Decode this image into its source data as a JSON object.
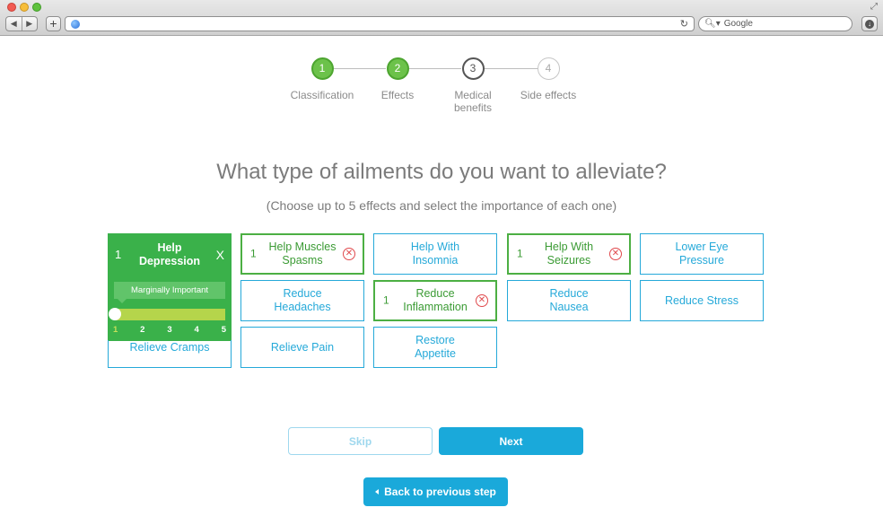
{
  "browser": {
    "search_placeholder": "Google",
    "back_glyph": "◀",
    "forward_glyph": "▶",
    "new_tab_glyph": "+",
    "reload_glyph": "↻",
    "resize_glyph": "⤢",
    "search_glyph": "🔍︎▾",
    "download_glyph": "↓"
  },
  "stepper": {
    "steps": [
      {
        "number": "1",
        "label": "Classification",
        "state": "done"
      },
      {
        "number": "2",
        "label": "Effects",
        "state": "done"
      },
      {
        "number": "3",
        "label": "Medical benefits",
        "state": "current"
      },
      {
        "number": "4",
        "label": "Side effects",
        "state": "todo"
      }
    ]
  },
  "question": {
    "title": "What type of ailments do you want to alleviate?",
    "subtitle": "(Choose up to 5 effects and select the importance of each one)"
  },
  "expanded_card": {
    "rank": "1",
    "label": "Help Depression",
    "close": "X",
    "tooltip": "Marginally Important",
    "importance": 1,
    "scale": [
      "1",
      "2",
      "3",
      "4",
      "5"
    ],
    "below_label": "Relieve Cramps"
  },
  "effects": [
    {
      "label": "Help Muscles Spasms",
      "selected": true,
      "rank": "1"
    },
    {
      "label": "Help With Insomnia",
      "selected": false
    },
    {
      "label": "Help With Seizures",
      "selected": true,
      "rank": "1"
    },
    {
      "label": "Lower Eye Pressure",
      "selected": false
    },
    {
      "label": "Reduce Headaches",
      "selected": false
    },
    {
      "label": "Reduce Inflammation",
      "selected": true,
      "rank": "1"
    },
    {
      "label": "Reduce Nausea",
      "selected": false
    },
    {
      "label": "Reduce Stress",
      "selected": false
    },
    {
      "label": "Relieve Pain",
      "selected": false
    },
    {
      "label": "Restore Appetite",
      "selected": false
    }
  ],
  "remove_glyph": "✕",
  "actions": {
    "skip": "Skip",
    "next": "Next",
    "back": "Back to previous step"
  },
  "colors": {
    "accent_blue": "#1aa9da",
    "selected_green": "#4caf43",
    "remove_red": "#e0494c"
  }
}
